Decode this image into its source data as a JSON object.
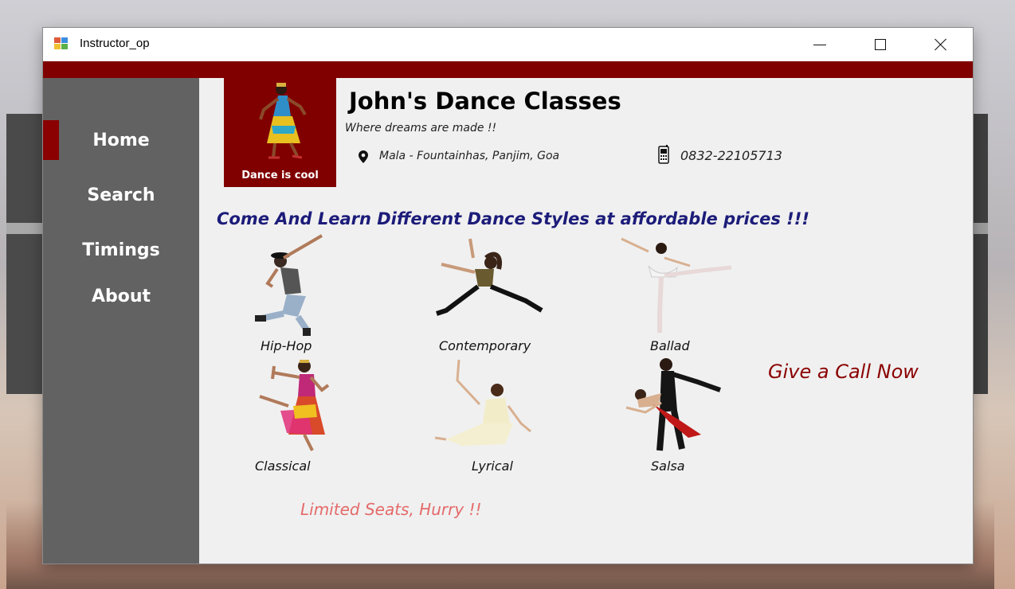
{
  "window": {
    "title": "Instructor_op",
    "controls": {
      "minimize": "minimize",
      "maximize": "maximize",
      "close": "close"
    }
  },
  "colors": {
    "accent": "#800000",
    "sidebar": "#626262",
    "headline": "#1c1c7a",
    "call_now": "#8b0000",
    "limited": "#e46a6a"
  },
  "sidebar": {
    "items": [
      {
        "label": "Home",
        "active": true
      },
      {
        "label": "Search",
        "active": false
      },
      {
        "label": "Timings",
        "active": false
      },
      {
        "label": "About",
        "active": false
      }
    ]
  },
  "brand": {
    "logo_caption": "Dance is cool",
    "title": "John's Dance Classes",
    "tagline": "Where dreams are made !!",
    "address": "Mala - Fountainhas, Panjim, Goa",
    "phone": "0832-22105713",
    "address_icon": "map-pin-icon",
    "phone_icon": "phone-icon"
  },
  "headline": "Come And Learn Different Dance Styles at affordable prices !!!",
  "styles": [
    {
      "label": "Hip-Hop"
    },
    {
      "label": "Contemporary"
    },
    {
      "label": "Ballad"
    },
    {
      "label": "Classical"
    },
    {
      "label": "Lyrical"
    },
    {
      "label": "Salsa"
    }
  ],
  "call_now": "Give a Call Now",
  "limited": "Limited Seats, Hurry !!"
}
